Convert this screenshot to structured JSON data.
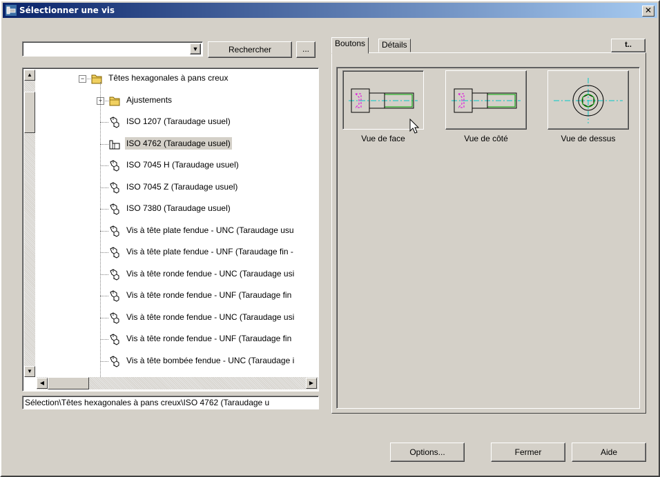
{
  "window": {
    "title": "Sélectionner une vis",
    "close_glyph": "✕"
  },
  "search": {
    "value": "",
    "button": "Rechercher",
    "more": "..."
  },
  "tree": {
    "rows": [
      {
        "label": "Têtes hexagonales à pans creux",
        "icon": "folder-icon"
      },
      {
        "label": "Ajustements",
        "icon": "folder-icon"
      },
      {
        "label": "ISO 1207  (Taraudage usuel)",
        "icon": "screw-icon"
      },
      {
        "label": "ISO 4762  (Taraudage usuel)",
        "icon": "screw-icon"
      },
      {
        "label": "ISO 7045  H  (Taraudage usuel)",
        "icon": "screw-icon"
      },
      {
        "label": "ISO 7045  Z  (Taraudage usuel)",
        "icon": "screw-icon"
      },
      {
        "label": "ISO 7380  (Taraudage usuel)",
        "icon": "screw-icon"
      },
      {
        "label": "Vis à tête plate fendue - UNC (Taraudage usu",
        "icon": "screw-icon"
      },
      {
        "label": "Vis à tête plate fendue - UNF (Taraudage fin -",
        "icon": "screw-icon"
      },
      {
        "label": "Vis à tête ronde fendue - UNC (Taraudage usi",
        "icon": "screw-icon"
      },
      {
        "label": "Vis à tête ronde fendue - UNF (Taraudage fin",
        "icon": "screw-icon"
      },
      {
        "label": "Vis à tête ronde fendue - UNC (Taraudage usi",
        "icon": "screw-icon"
      },
      {
        "label": "Vis à tête ronde fendue - UNF (Taraudage fin",
        "icon": "screw-icon"
      },
      {
        "label": "Vis à tête bombée fendue - UNC (Taraudage i",
        "icon": "screw-icon"
      }
    ],
    "selected_index": 3
  },
  "status": "Sélection\\Têtes hexagonales à pans creux\\ISO 4762  (Taraudage u",
  "tabs": [
    "Boutons",
    "Détails"
  ],
  "up_button": "t..",
  "views": [
    {
      "label": "Vue de face"
    },
    {
      "label": "Vue de côté"
    },
    {
      "label": "Vue de dessus"
    }
  ],
  "buttons": {
    "options": "Options...",
    "close": "Fermer",
    "help": "Aide"
  },
  "colors": {
    "title_start": "#0a246a",
    "title_end": "#a6caf0",
    "face": "#d4d0c8",
    "centerline": "#00c8c8",
    "thread": "#00aa00",
    "hidden": "#e000e0"
  }
}
